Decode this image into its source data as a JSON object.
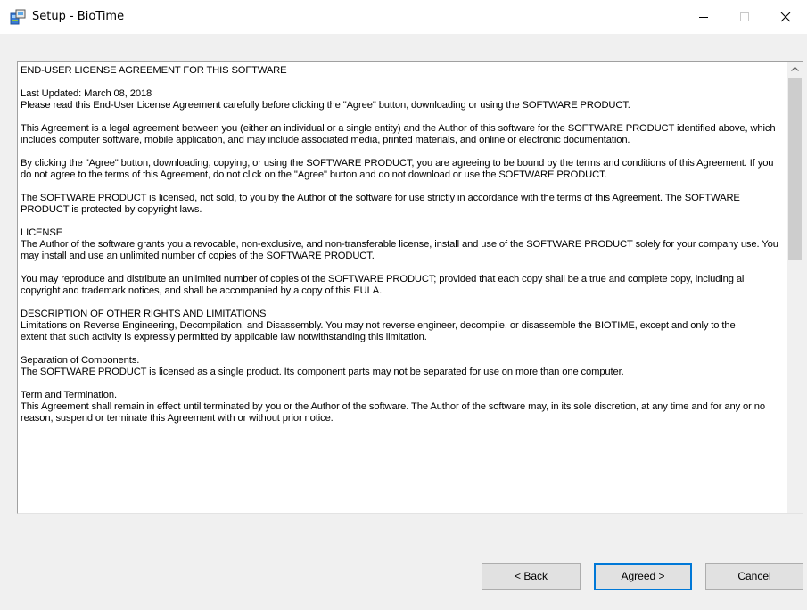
{
  "window": {
    "title": "Setup - BioTime",
    "controls": [
      "minimize",
      "maximize",
      "close"
    ]
  },
  "eula": {
    "paragraphs": [
      "END-USER LICENSE AGREEMENT FOR THIS SOFTWARE",
      "Last Updated: March 08, 2018\nPlease read this End-User License Agreement carefully before clicking the \"Agree\" button, downloading or using the SOFTWARE PRODUCT.",
      "This Agreement is a legal agreement between you (either an individual or a single entity) and the Author of this software for the SOFTWARE PRODUCT identified above, which includes computer software, mobile application, and may include associated media, printed materials, and online or electronic documentation.",
      "By clicking the \"Agree\" button, downloading, copying, or using the SOFTWARE PRODUCT, you are agreeing to be bound by the terms and conditions of this Agreement. If you do not agree to the terms of this Agreement, do not click on the \"Agree\" button and do not download or use the SOFTWARE PRODUCT.",
      "The SOFTWARE PRODUCT is licensed, not sold, to you by the Author of the software for use strictly in accordance with the terms of this Agreement. The SOFTWARE PRODUCT is protected by copyright laws.",
      "LICENSE\nThe Author of the software grants you a revocable, non-exclusive, and non-transferable license,  install and use of the SOFTWARE PRODUCT solely for your company use. You may install and use an unlimited number of copies of the SOFTWARE PRODUCT.",
      "You may reproduce and distribute an unlimited number of copies of the SOFTWARE PRODUCT; provided that each copy shall be a true and complete copy, including all copyright and trademark notices, and shall be accompanied by a copy of this EULA.",
      "DESCRIPTION OF OTHER RIGHTS AND LIMITATIONS\nLimitations on Reverse Engineering, Decompilation, and Disassembly. You may not reverse engineer, decompile, or disassemble the BIOTIME, except and only to the\nextent that such activity is expressly permitted by applicable law notwithstanding this limitation.",
      "Separation of Components.\nThe SOFTWARE PRODUCT is licensed as a single product. Its component parts may not be separated for use on more than one computer.",
      "Term and Termination.\nThis Agreement shall remain in effect until terminated by you or the Author of the software. The Author of the software may, in its sole discretion, at any time and for any or no reason, suspend or terminate this Agreement with or without prior notice."
    ]
  },
  "buttons": {
    "back_prefix": "< ",
    "back_mnemonic": "B",
    "back_rest": "ack",
    "agree": "Agreed >",
    "cancel": "Cancel"
  }
}
